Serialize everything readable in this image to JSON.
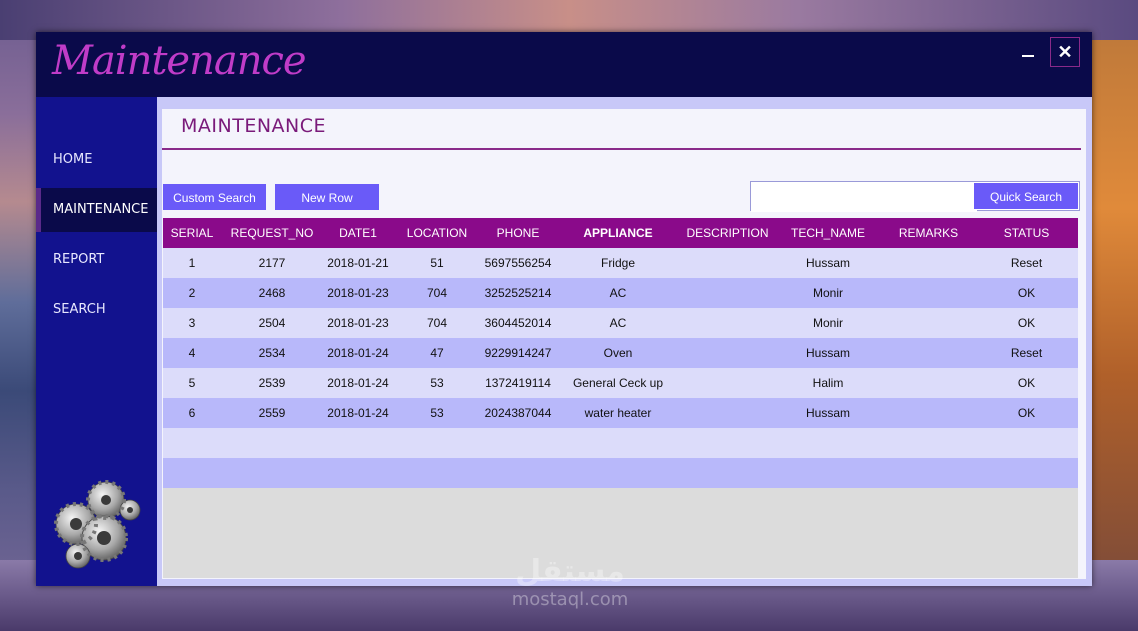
{
  "window": {
    "app_title": "Maintenance"
  },
  "controls": {
    "minimize_icon": "minimize-icon",
    "close_icon": "close-icon",
    "close_glyph": "✕"
  },
  "sidebar": {
    "items": [
      {
        "label": "HOME",
        "active": false
      },
      {
        "label": "MAINTENANCE",
        "active": true
      },
      {
        "label": "REPORT",
        "active": false
      },
      {
        "label": "SEARCH",
        "active": false
      }
    ],
    "logo_icon": "gears-icon"
  },
  "main": {
    "page_title": "MAINTENANCE",
    "buttons": {
      "custom_search": "Custom Search",
      "new_row": "New Row",
      "quick_search": "Quick Search"
    },
    "search": {
      "value": "",
      "placeholder": ""
    },
    "table": {
      "columns": [
        "SERIAL",
        "REQUEST_NO",
        "DATE1",
        "LOCATION",
        "PHONE",
        "APPLIANCE",
        "DESCRIPTION",
        "TECH_NAME",
        "REMARKS",
        "STATUS"
      ],
      "rows": [
        [
          "1",
          "2177",
          "2018-01-21",
          "51",
          "5697556254",
          "Fridge",
          "",
          "Hussam",
          "",
          "Reset"
        ],
        [
          "2",
          "2468",
          "2018-01-23",
          "704",
          "3252525214",
          "AC",
          "",
          "Monir",
          "",
          "OK"
        ],
        [
          "3",
          "2504",
          "2018-01-23",
          "704",
          "3604452014",
          "AC",
          "",
          "Monir",
          "",
          "OK"
        ],
        [
          "4",
          "2534",
          "2018-01-24",
          "47",
          "9229914247",
          "Oven",
          "",
          "Hussam",
          "",
          "Reset"
        ],
        [
          "5",
          "2539",
          "2018-01-24",
          "53",
          "1372419114",
          "General Ceck up",
          "",
          "Halim",
          "",
          "OK"
        ],
        [
          "6",
          "2559",
          "2018-01-24",
          "53",
          "2024387044",
          "water heater",
          "",
          "Hussam",
          "",
          "OK"
        ],
        [
          "",
          "",
          "",
          "",
          "",
          "",
          "",
          "",
          "",
          ""
        ],
        [
          "",
          "",
          "",
          "",
          "",
          "",
          "",
          "",
          "",
          ""
        ]
      ]
    }
  },
  "watermark": {
    "arabic": "مستقل",
    "latin": "mostaql.com"
  },
  "colors": {
    "titlebar": "#0a0a4a",
    "sidebar": "#12128e",
    "header": "#8a0a8a",
    "button": "#6a5af8",
    "row_light": "#dcdcfa",
    "row_dark": "#b8b8fa"
  }
}
